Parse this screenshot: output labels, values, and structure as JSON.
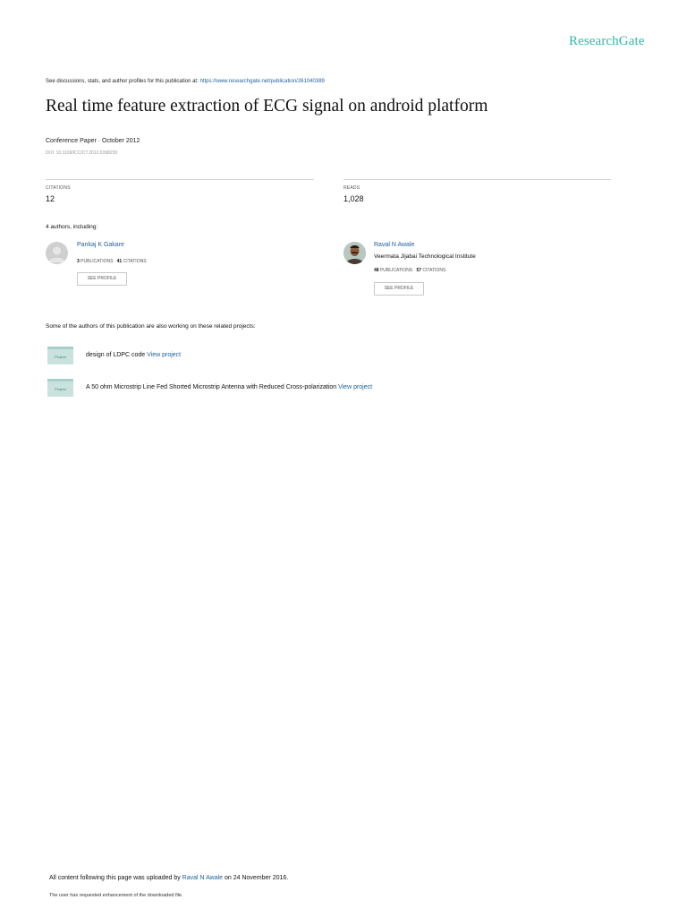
{
  "header": {
    "logo": "ResearchGate",
    "discussion_prefix": "See discussions, stats, and author profiles for this publication at: ",
    "discussion_url": "https://www.researchgate.net/publication/261040389"
  },
  "paper": {
    "title": "Real time feature extraction of ECG signal on android platform",
    "type_date": "Conference Paper · October 2012",
    "doi": "DOI: 10.1109/ICCICT.2012.6398230"
  },
  "stats": {
    "citations_label": "CITATIONS",
    "citations_value": "12",
    "reads_label": "READS",
    "reads_value": "1,028"
  },
  "authors_label": "4 authors, including:",
  "authors": [
    {
      "name": "Pankaj K Gakare",
      "institution": "",
      "publications": "3",
      "publications_label": "PUBLICATIONS",
      "citations": "41",
      "citations_label": "CITATIONS",
      "button": "SEE PROFILE"
    },
    {
      "name": "Raval N Awale",
      "institution": "Veermata Jijabai Technological Institute",
      "publications": "48",
      "publications_label": "PUBLICATIONS",
      "citations": "57",
      "citations_label": "CITATIONS",
      "button": "SEE PROFILE"
    }
  ],
  "related_label": "Some of the authors of this publication are also working on these related projects:",
  "projects": [
    {
      "icon_label": "Project",
      "text": "design of LDPC code ",
      "link": "View project"
    },
    {
      "icon_label": "Project",
      "text": "A 50 ohm Microstrip Line Fed Shorted Microstrip Antenna with Reduced Cross-polarization ",
      "link": "View project"
    }
  ],
  "footer": {
    "uploaded_prefix": "All content following this page was uploaded by ",
    "uploaded_by": "Raval N Awale",
    "uploaded_suffix": " on 24 November 2016.",
    "enhancement_note": "The user has requested enhancement of the downloaded file."
  },
  "colors": {
    "brand": "#2fb8a8",
    "link": "#1d5f9e"
  }
}
